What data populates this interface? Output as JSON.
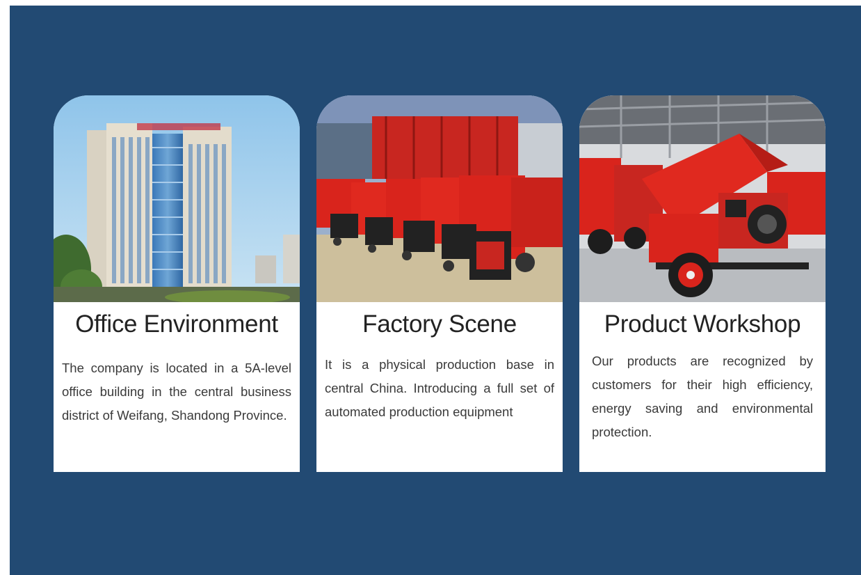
{
  "cards": [
    {
      "image_subject": "office-building-photo",
      "title": "Office Environment",
      "description": "The company is located in a 5A-level office building in the central business district of Weifang, Shandong Province."
    },
    {
      "image_subject": "factory-machines-photo",
      "title": "Factory Scene",
      "description": "It is a physical production base in central China. Introducing a full set of automated production equipment"
    },
    {
      "image_subject": "workshop-chipper-photo",
      "title": "Product Workshop",
      "description": "Our products are recognized by customers for their high efficiency, energy saving and environmental protection."
    }
  ],
  "colors": {
    "background": "#224a73",
    "card": "#ffffff",
    "machine_red": "#d9241c"
  }
}
